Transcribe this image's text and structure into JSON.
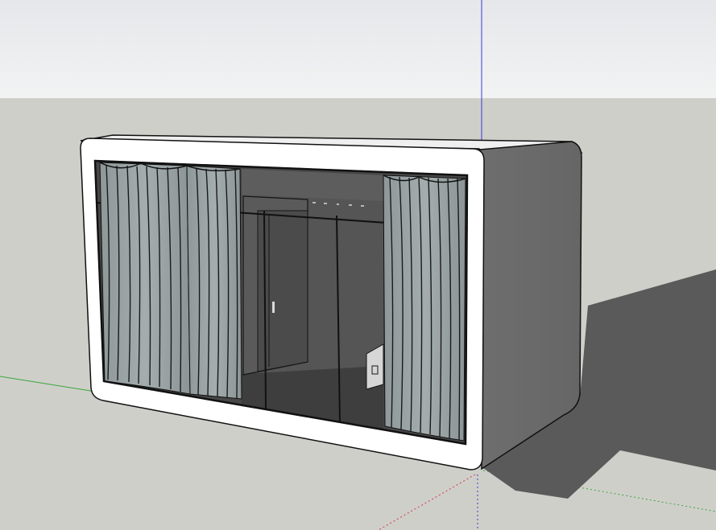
{
  "viewport": {
    "sky_color": "#e9ebed",
    "ground_color": "#cfcfca",
    "axis_colors": {
      "red": "#d23a3a",
      "green": "#39a839",
      "blue": "#3a3ad8"
    }
  },
  "model": {
    "frame_color": "#ffffff",
    "side_color": "#6b6b6b",
    "glass_color": "#474747",
    "curtain_color": "#9aa3a3",
    "interior_color": "#4f4f4f",
    "shadow_color": "#5a5a5a",
    "icons": [
      "cabin-model",
      "curtain-left",
      "curtain-right",
      "interior-door",
      "interior-box"
    ]
  }
}
